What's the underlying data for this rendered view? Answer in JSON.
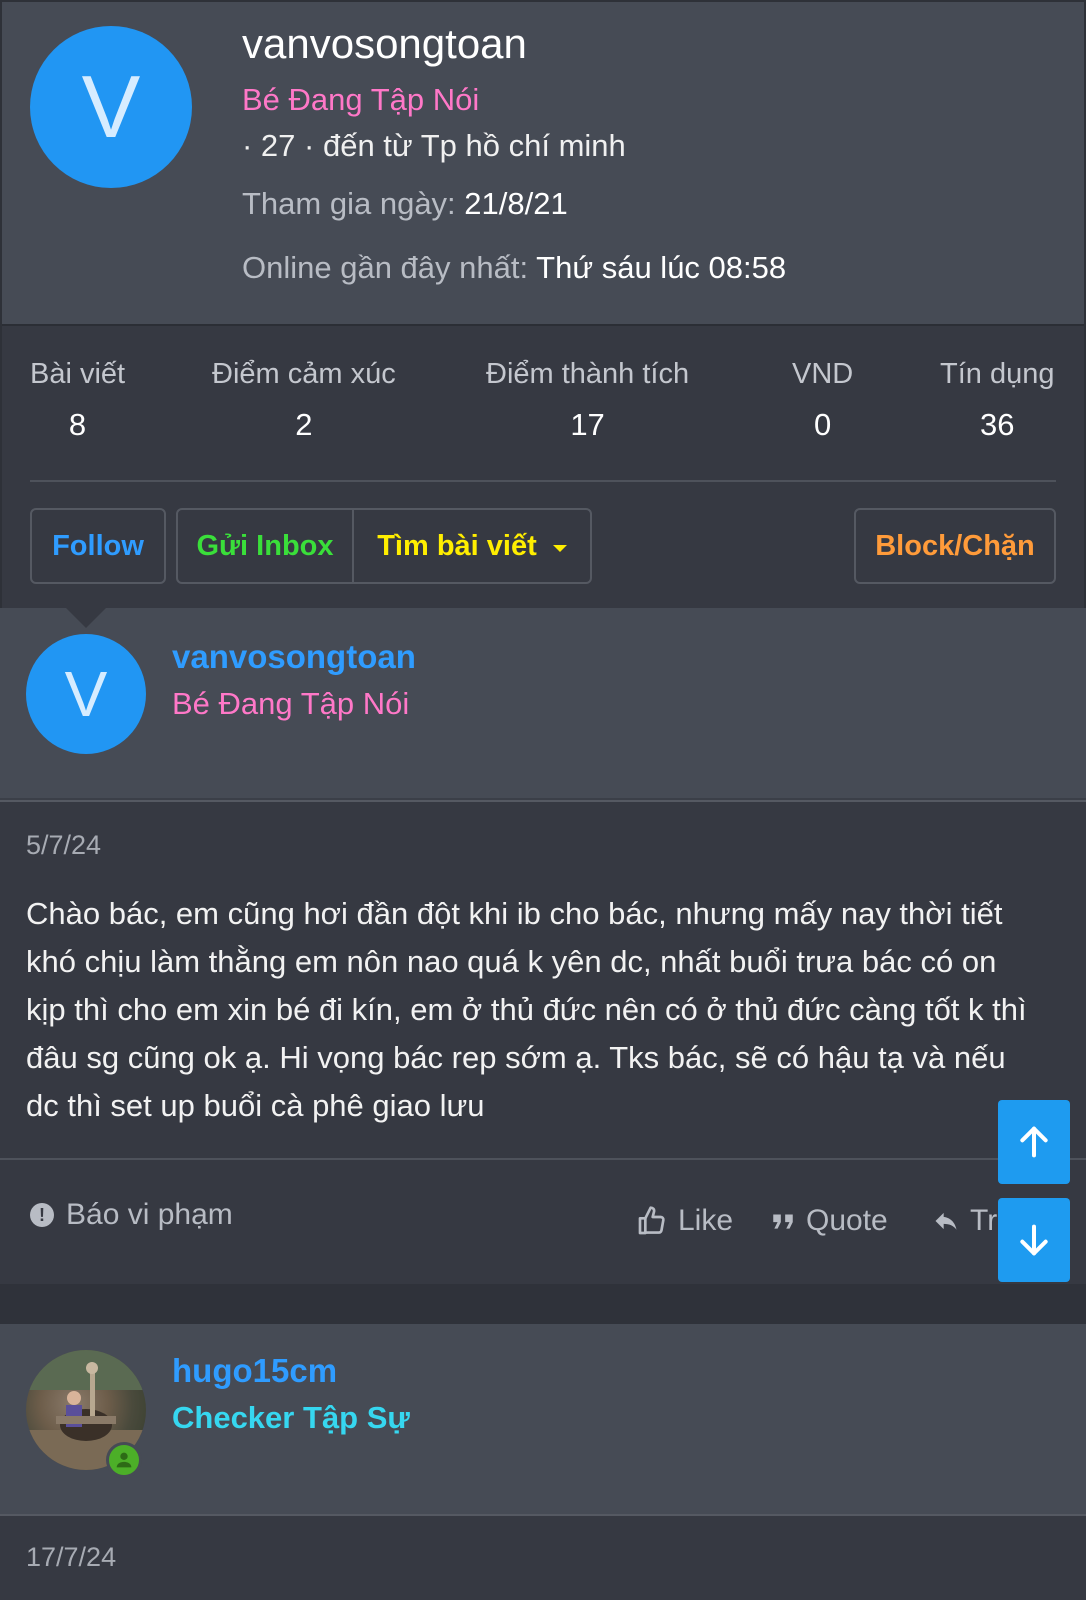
{
  "profile_popup": {
    "avatar_letter": "V",
    "username": "vanvosongtoan",
    "user_title": "Bé Đang Tập Nói",
    "meta": "· 27 · đến từ Tp hồ chí minh",
    "joined_label": "Tham gia ngày:",
    "joined_value": "21/8/21",
    "last_seen_label": "Online gần đây nhất:",
    "last_seen_value": "Thứ sáu lúc 08:58",
    "stats": [
      {
        "label": "Bài viết",
        "value": "8"
      },
      {
        "label": "Điểm cảm xúc",
        "value": "2"
      },
      {
        "label": "Điểm thành tích",
        "value": "17"
      },
      {
        "label": "VND",
        "value": "0"
      },
      {
        "label": "Tín dụng",
        "value": "36"
      }
    ],
    "buttons": {
      "follow": "Follow",
      "inbox": "Gửi Inbox",
      "find_posts": "Tìm bài viết",
      "block": "Block/Chặn"
    }
  },
  "messages": [
    {
      "avatar_letter": "V",
      "username": "vanvosongtoan",
      "user_title": "Bé Đang Tập Nói",
      "user_title_color": "#ff78c8",
      "date": "5/7/24",
      "text": "Chào bác, em cũng hơi đần đột khi ib cho bác, nhưng mấy nay thời tiết khó chịu làm thằng em nôn nao quá k yên dc, nhất buổi trưa bác có on kịp thì cho em xin bé đi kín, em ở thủ đức nên có ở thủ đức càng tốt k thì đâu sg cũng ok ạ. Hi vọng bác rep sớm ạ. Tks bác, sẽ có hậu tạ và nếu dc thì set up buổi cà phê giao lưu",
      "actions": {
        "report": "Báo vi phạm",
        "like": "Like",
        "quote": "Quote",
        "reply": "Tr"
      }
    },
    {
      "username": "hugo15cm",
      "user_title": "Checker Tập Sự",
      "user_title_color": "#36d7f0",
      "date": "17/7/24"
    }
  ],
  "colors": {
    "accent_blue": "#2f9cff",
    "follow": "#2f9cff",
    "inbox": "#3adf3a",
    "find": "#ffee00",
    "block": "#ff9b3a",
    "scroll_button": "#1e9bf0"
  }
}
